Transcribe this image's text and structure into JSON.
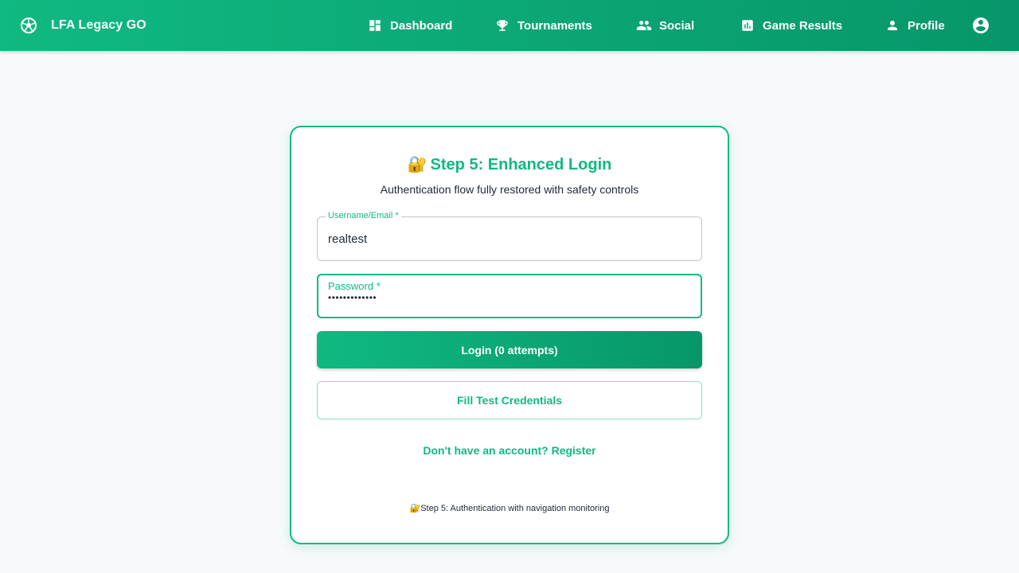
{
  "app": {
    "title": "LFA Legacy GO",
    "brand_color": "#10b981",
    "brand_color_dark": "#079669"
  },
  "nav": {
    "items": [
      {
        "label": "Dashboard",
        "icon": "dashboard-icon"
      },
      {
        "label": "Tournaments",
        "icon": "trophy-icon"
      },
      {
        "label": "Social",
        "icon": "people-icon"
      },
      {
        "label": "Game Results",
        "icon": "bar-chart-icon"
      },
      {
        "label": "Profile",
        "icon": "person-icon"
      }
    ],
    "account_icon": "account-circle-icon"
  },
  "login": {
    "title_emoji": "🔐",
    "title": "Step 5: Enhanced Login",
    "subtitle": "Authentication flow fully restored with safety controls",
    "username": {
      "label": "Username/Email *",
      "value": "realtest"
    },
    "password": {
      "label": "Password *",
      "value": "•••••••••••••"
    },
    "login_button": "Login (0 attempts)",
    "fill_button": "Fill Test Credentials",
    "register_link": "Don't have an account? Register",
    "footer_emoji": "🔐",
    "footer_note": "Step 5: Authentication with navigation monitoring"
  }
}
